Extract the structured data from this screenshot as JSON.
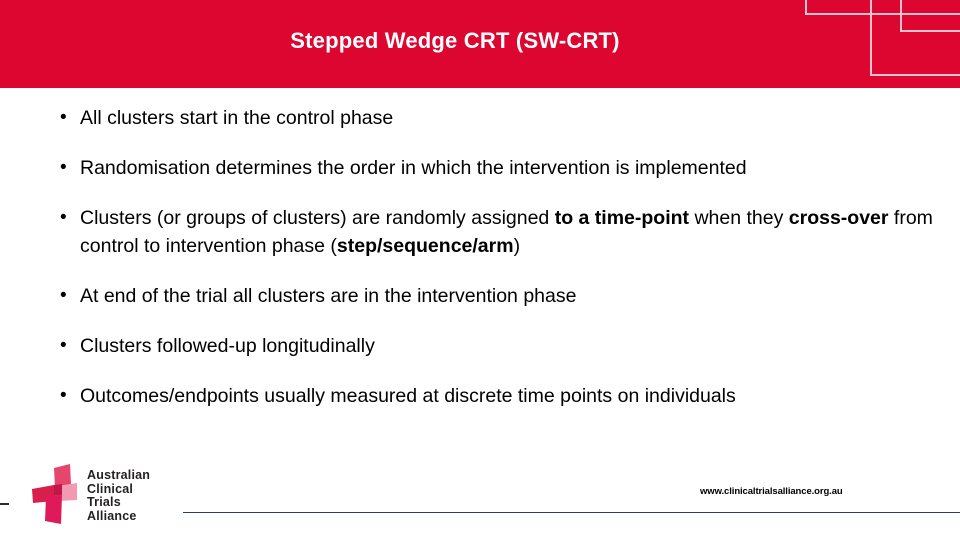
{
  "slide": {
    "title": "Stepped Wedge CRT (SW-CRT)",
    "accent_color": "#dc0630",
    "deco_line_color": "#f2c3cf",
    "bullet_glyph": "•"
  },
  "bullets": [
    {
      "id": "bullet-1",
      "text": "All clusters start in the control phase",
      "segments": [
        {
          "text": "All clusters start in the control phase",
          "bold": false
        }
      ]
    },
    {
      "id": "bullet-2",
      "text": "Randomisation determines the order in which the intervention is implemented",
      "segments": [
        {
          "text": "Randomisation determines the order in which the intervention is implemented",
          "bold": false
        }
      ]
    },
    {
      "id": "bullet-3",
      "text": "Clusters (or groups of clusters) are randomly assigned to a time-point when they cross-over from control to intervention phase (step/sequence/arm)",
      "segments": [
        {
          "text": "Clusters (or groups of clusters) are randomly assigned ",
          "bold": false
        },
        {
          "text": "to a time-point",
          "bold": true
        },
        {
          "text": " when they ",
          "bold": false
        },
        {
          "text": "cross-over",
          "bold": true
        },
        {
          "text": " from control to intervention phase (",
          "bold": false
        },
        {
          "text": "step/sequence/arm",
          "bold": true
        },
        {
          "text": ")",
          "bold": false
        }
      ]
    },
    {
      "id": "bullet-4",
      "text": "At end of the trial all clusters are in the intervention phase",
      "segments": [
        {
          "text": "At end of the trial all clusters are in the intervention phase",
          "bold": false
        }
      ]
    },
    {
      "id": "bullet-5",
      "text": "Clusters followed-up longitudinally",
      "segments": [
        {
          "text": "Clusters followed-up longitudinally",
          "bold": false
        }
      ]
    },
    {
      "id": "bullet-6",
      "text": "Outcomes/endpoints usually measured at discrete time points on individuals",
      "segments": [
        {
          "text": "Outcomes/endpoints usually measured at discrete time points on individuals",
          "bold": false
        }
      ]
    }
  ],
  "footer": {
    "url": "www.clinicaltrialsalliance.org.au",
    "rule_color": "#2b3a67"
  },
  "logo": {
    "name": "australian-clinical-trials-alliance-logo",
    "lines": [
      "Australian",
      "Clinical",
      "Trials",
      "Alliance"
    ],
    "mark_colors": [
      "#e5466b",
      "#f29ab0",
      "#d81e4a",
      "#e0195a"
    ]
  }
}
